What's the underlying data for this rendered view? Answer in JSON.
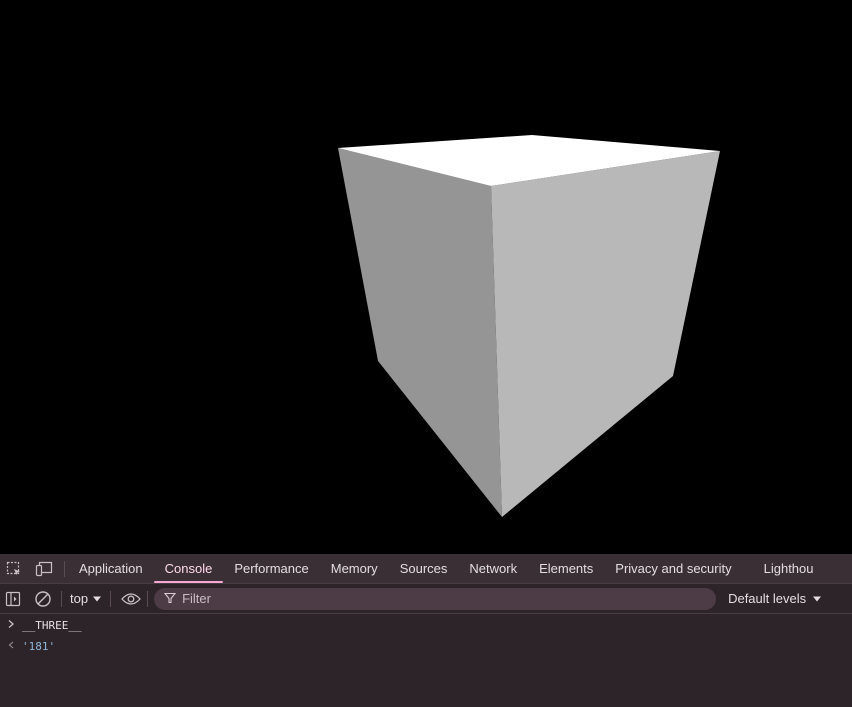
{
  "viewport": {
    "colors": {
      "background": "#000000",
      "cube_top": "#ffffff",
      "cube_left": "#959595",
      "cube_right": "#b8b8b8"
    }
  },
  "devtools": {
    "tabs": [
      {
        "label": "Application",
        "active": false
      },
      {
        "label": "Console",
        "active": true
      },
      {
        "label": "Performance",
        "active": false
      },
      {
        "label": "Memory",
        "active": false
      },
      {
        "label": "Sources",
        "active": false
      },
      {
        "label": "Network",
        "active": false
      },
      {
        "label": "Elements",
        "active": false
      },
      {
        "label": "Privacy and security",
        "active": false
      },
      {
        "label": "Lighthou",
        "active": false
      }
    ],
    "toolbar": {
      "context": "top",
      "filter_placeholder": "Filter",
      "levels": "Default levels"
    },
    "console": {
      "input": "__THREE__",
      "result": "'181'"
    },
    "colors": {
      "accent": "#f4a8d4",
      "panel_bg": "#2d2429",
      "tabbar_bg": "#3a2f35",
      "result": "#8fb5d9"
    }
  }
}
